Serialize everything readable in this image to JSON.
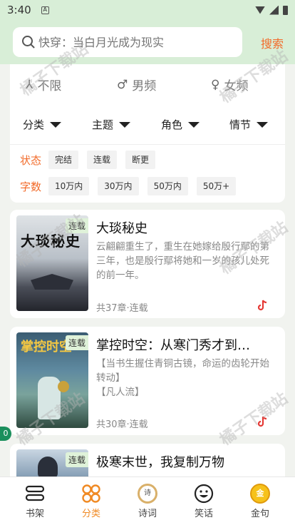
{
  "status": {
    "time": "3:40",
    "notif_glyph": "A"
  },
  "search": {
    "placeholder": "快穿：当白月光成为现实",
    "button": "搜索"
  },
  "gender_filters": [
    {
      "icon": "⅄",
      "label": "不限"
    },
    {
      "icon": "♂",
      "label": "男频"
    },
    {
      "icon": "♀",
      "label": "女频"
    }
  ],
  "category_filters": [
    "分类",
    "主题",
    "角色",
    "情节"
  ],
  "status_filter": {
    "label": "状态",
    "options": [
      "完结",
      "连载",
      "断更"
    ]
  },
  "wordcount_filter": {
    "label": "字数",
    "options": [
      "10万内",
      "30万内",
      "50万内",
      "50万+"
    ]
  },
  "books": [
    {
      "title": "大琰秘史",
      "badge": "连载",
      "cover_text": "大琰秘史",
      "description": "云翩翩重生了，重生在她嫁给殷行鄢的第三年，也是殷行鄢将她和一岁的孩儿处死的前一年。",
      "meta": "共37章·连载"
    },
    {
      "title": "掌控时空：从寒门秀才到…",
      "badge": "连载",
      "cover_text": "掌控时空",
      "description": "【当书生握住青铜古镜，命运的齿轮开始转动】\n【凡人流】",
      "meta": "共30章·连载"
    },
    {
      "title": "极寒末世，我复制万物",
      "badge": "连载",
      "cover_text": "",
      "description": "",
      "meta": ""
    }
  ],
  "side_pill": "0",
  "nav": [
    {
      "icon": "bookshelf-icon",
      "label": "书架"
    },
    {
      "icon": "category-icon",
      "label": "分类"
    },
    {
      "icon": "poem-icon",
      "label": "诗词"
    },
    {
      "icon": "joke-icon",
      "label": "笑话"
    },
    {
      "icon": "golden-quote-icon",
      "label": "金句"
    }
  ],
  "nav_active": "分类",
  "nav_poem_glyph": "诗",
  "nav_quote_glyph": "金",
  "watermark": "橘子下载站",
  "colors": {
    "accent": "#f26b2a",
    "nav_active": "#f08a24",
    "header_bg": "#d8eed7",
    "badge_bg": "#dff2d9"
  }
}
